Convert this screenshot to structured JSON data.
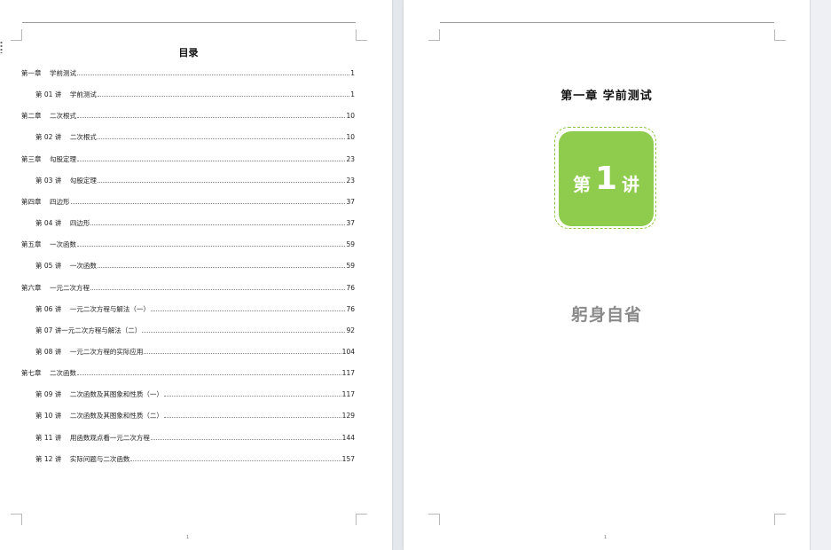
{
  "toc": {
    "title": "目录",
    "entries": [
      {
        "text": "第一章    学前测试",
        "page": "1",
        "level": 0
      },
      {
        "text": "第 01 讲    学前测试",
        "page": "1",
        "level": 1
      },
      {
        "text": "第二章    二次根式",
        "page": "10",
        "level": 0
      },
      {
        "text": "第 02 讲    二次根式",
        "page": "10",
        "level": 1
      },
      {
        "text": "第三章    勾股定理",
        "page": "23",
        "level": 0
      },
      {
        "text": "第 03 讲    勾股定理",
        "page": "23",
        "level": 1
      },
      {
        "text": "第四章    四边形",
        "page": "37",
        "level": 0
      },
      {
        "text": "第 04 讲    四边形",
        "page": "37",
        "level": 1
      },
      {
        "text": "第五章    一次函数",
        "page": "59",
        "level": 0
      },
      {
        "text": "第 05 讲    一次函数",
        "page": "59",
        "level": 1
      },
      {
        "text": "第六章    一元二次方程",
        "page": "76",
        "level": 0
      },
      {
        "text": "第 06 讲    一元二次方程与解法（一）",
        "page": "76",
        "level": 1
      },
      {
        "text": "第 07 讲一元二次方程与解法（二）",
        "page": "92",
        "level": 1
      },
      {
        "text": "第 08 讲    一元二次方程的实际应用",
        "page": "104",
        "level": 1
      },
      {
        "text": "第七章    二次函数",
        "page": "117",
        "level": 0
      },
      {
        "text": "第 09 讲    二次函数及其图象和性质（一）",
        "page": "117",
        "level": 1
      },
      {
        "text": "第 10 讲    二次函数及其图象和性质（二）",
        "page": "129",
        "level": 1
      },
      {
        "text": "第 11 讲    用函数观点看一元二次方程",
        "page": "144",
        "level": 1
      },
      {
        "text": "第 12 讲    实际问题与二次函数",
        "page": "157",
        "level": 1
      }
    ]
  },
  "left_page_number": "1",
  "right_page": {
    "chapter_heading": "第一章   学前测试",
    "badge": {
      "prefix": "第",
      "number": "1",
      "suffix": "讲"
    },
    "subtitle": "躬身自省",
    "page_number": "1"
  },
  "colors": {
    "badge_fill": "#8fcb4c",
    "badge_border": "#8cc63f",
    "subtitle": "#8a8a8a",
    "workspace": "#e4e7ec"
  }
}
